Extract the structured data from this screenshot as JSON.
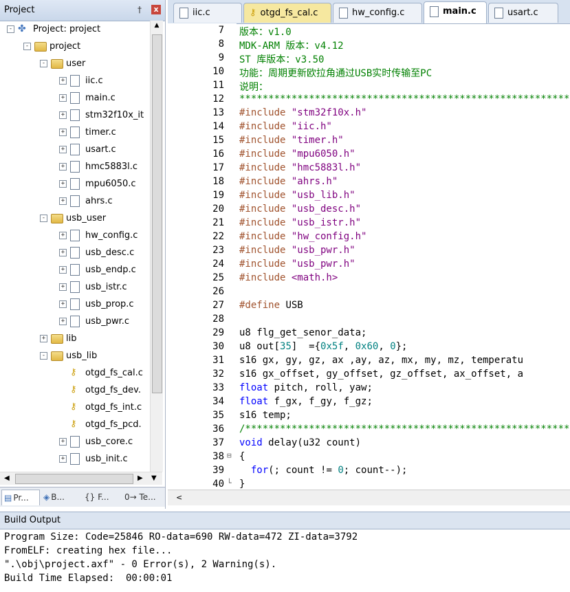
{
  "project_panel": {
    "title": "Project",
    "pin": "†",
    "close": "x",
    "tree": [
      {
        "label": "Project: project",
        "indent": 0,
        "exp": "-",
        "icon": "project"
      },
      {
        "label": "project",
        "indent": 1,
        "exp": "-",
        "icon": "folder"
      },
      {
        "label": "user",
        "indent": 2,
        "exp": "-",
        "icon": "folder"
      },
      {
        "label": "iic.c",
        "indent": 3,
        "exp": "+",
        "icon": "file"
      },
      {
        "label": "main.c",
        "indent": 3,
        "exp": "+",
        "icon": "file"
      },
      {
        "label": "stm32f10x_it",
        "indent": 3,
        "exp": "+",
        "icon": "file"
      },
      {
        "label": "timer.c",
        "indent": 3,
        "exp": "+",
        "icon": "file"
      },
      {
        "label": "usart.c",
        "indent": 3,
        "exp": "+",
        "icon": "file"
      },
      {
        "label": "hmc5883l.c",
        "indent": 3,
        "exp": "+",
        "icon": "file"
      },
      {
        "label": "mpu6050.c",
        "indent": 3,
        "exp": "+",
        "icon": "file"
      },
      {
        "label": "ahrs.c",
        "indent": 3,
        "exp": "+",
        "icon": "file"
      },
      {
        "label": "usb_user",
        "indent": 2,
        "exp": "-",
        "icon": "folder"
      },
      {
        "label": "hw_config.c",
        "indent": 3,
        "exp": "+",
        "icon": "file"
      },
      {
        "label": "usb_desc.c",
        "indent": 3,
        "exp": "+",
        "icon": "file"
      },
      {
        "label": "usb_endp.c",
        "indent": 3,
        "exp": "+",
        "icon": "file"
      },
      {
        "label": "usb_istr.c",
        "indent": 3,
        "exp": "+",
        "icon": "file"
      },
      {
        "label": "usb_prop.c",
        "indent": 3,
        "exp": "+",
        "icon": "file"
      },
      {
        "label": "usb_pwr.c",
        "indent": 3,
        "exp": "+",
        "icon": "file"
      },
      {
        "label": "lib",
        "indent": 2,
        "exp": "+",
        "icon": "folder"
      },
      {
        "label": "usb_lib",
        "indent": 2,
        "exp": "-",
        "icon": "folder"
      },
      {
        "label": "otgd_fs_cal.c",
        "indent": 3,
        "exp": "",
        "icon": "key"
      },
      {
        "label": "otgd_fs_dev.",
        "indent": 3,
        "exp": "",
        "icon": "key"
      },
      {
        "label": "otgd_fs_int.c",
        "indent": 3,
        "exp": "",
        "icon": "key"
      },
      {
        "label": "otgd_fs_pcd.",
        "indent": 3,
        "exp": "",
        "icon": "key"
      },
      {
        "label": "usb_core.c",
        "indent": 3,
        "exp": "+",
        "icon": "file"
      },
      {
        "label": "usb_init.c",
        "indent": 3,
        "exp": "+",
        "icon": "file"
      }
    ],
    "bottom_tabs": [
      {
        "label": "Pr...",
        "icon": "project-icon"
      },
      {
        "label": "B...",
        "icon": "books-icon"
      },
      {
        "label": "{} F...",
        "icon": "functions-icon"
      },
      {
        "label": "0→ Te...",
        "icon": "templates-icon"
      }
    ]
  },
  "editor": {
    "tabs": [
      {
        "label": "iic.c",
        "key": false,
        "active": false
      },
      {
        "label": "otgd_fs_cal.c",
        "key": true,
        "active": false
      },
      {
        "label": "hw_config.c",
        "key": false,
        "active": false
      },
      {
        "label": "main.c",
        "key": false,
        "active": true
      },
      {
        "label": "usart.c",
        "key": false,
        "active": false
      }
    ],
    "lines": [
      {
        "n": "7",
        "t": "版本：v1.0",
        "c": "green"
      },
      {
        "n": "8",
        "t": "MDK-ARM 版本：v4.12",
        "c": "green"
      },
      {
        "n": "9",
        "t": "ST 库版本：v3.50",
        "c": "green"
      },
      {
        "n": "10",
        "t": "功能：周期更新欧拉角通过USB实时传输至PC",
        "c": "green"
      },
      {
        "n": "11",
        "t": "说明：",
        "c": "green"
      },
      {
        "n": "12",
        "t": "**************************************************************",
        "c": "green"
      },
      {
        "n": "13",
        "t": "#include \"stm32f10x.h\"",
        "c": "inc"
      },
      {
        "n": "14",
        "t": "#include \"iic.h\"",
        "c": "inc"
      },
      {
        "n": "15",
        "t": "#include \"timer.h\"",
        "c": "inc"
      },
      {
        "n": "16",
        "t": "#include \"mpu6050.h\"",
        "c": "inc"
      },
      {
        "n": "17",
        "t": "#include \"hmc5883l.h\"",
        "c": "inc"
      },
      {
        "n": "18",
        "t": "#include \"ahrs.h\"",
        "c": "inc"
      },
      {
        "n": "19",
        "t": "#include \"usb_lib.h\"",
        "c": "inc"
      },
      {
        "n": "20",
        "t": "#include \"usb_desc.h\"",
        "c": "inc"
      },
      {
        "n": "21",
        "t": "#include \"usb_istr.h\"",
        "c": "inc"
      },
      {
        "n": "22",
        "t": "#include \"hw_config.h\"",
        "c": "inc"
      },
      {
        "n": "23",
        "t": "#include \"usb_pwr.h\"",
        "c": "inc"
      },
      {
        "n": "24",
        "t": "#include \"usb_pwr.h\"",
        "c": "inc"
      },
      {
        "n": "25",
        "t": "#include <math.h>",
        "c": "inc"
      },
      {
        "n": "26",
        "t": "",
        "c": "plain"
      },
      {
        "n": "27",
        "t": "#define USB",
        "c": "define"
      },
      {
        "n": "28",
        "t": "",
        "c": "plain"
      },
      {
        "n": "29",
        "t": "u8 flg_get_senor_data;",
        "c": "plain"
      },
      {
        "n": "30",
        "t": "u8 out[35]  ={0x5f, 0x60, 0};",
        "c": "arr"
      },
      {
        "n": "31",
        "t": "s16 gx, gy, gz, ax ,ay, az, mx, my, mz, temperatu",
        "c": "plain"
      },
      {
        "n": "32",
        "t": "s16 gx_offset, gy_offset, gz_offset, ax_offset, a",
        "c": "plain"
      },
      {
        "n": "33",
        "t": "float pitch, roll, yaw;",
        "c": "float"
      },
      {
        "n": "34",
        "t": "float f_gx, f_gy, f_gz;",
        "c": "float"
      },
      {
        "n": "35",
        "t": "s16 temp;",
        "c": "plain"
      },
      {
        "n": "36",
        "t": "/*************************************************************",
        "c": "green"
      },
      {
        "n": "37",
        "t": "void delay(u32 count)",
        "c": "void"
      },
      {
        "n": "38",
        "t": "{",
        "c": "plain",
        "fold": "⊟"
      },
      {
        "n": "39",
        "t": "  for(; count != 0; count--);",
        "c": "for"
      },
      {
        "n": "40",
        "t": "}",
        "c": "plain",
        "fold": "└"
      }
    ]
  },
  "build_output": {
    "title": "Build Output",
    "lines": [
      "Program Size: Code=25846 RO-data=690 RW-data=472 ZI-data=3792",
      "FromELF: creating hex file...",
      "\".\\obj\\project.axf\" - 0 Error(s), 2 Warning(s).",
      "Build Time Elapsed:  00:00:01"
    ]
  },
  "colors": {
    "comment": "#008000",
    "preprocessor": "#a0522d",
    "string": "#7f007f",
    "keyword": "#0000ff",
    "number": "#008080"
  }
}
